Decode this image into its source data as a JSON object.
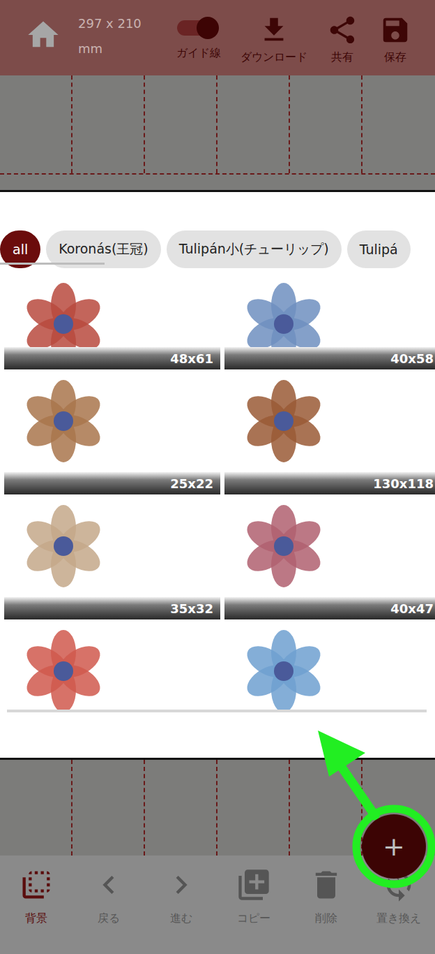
{
  "topbar": {
    "size": "297 x 210",
    "unit": "mm",
    "guide": {
      "label": "ガイド線",
      "on": true
    },
    "actions": [
      {
        "label": "ダウンロード"
      },
      {
        "label": "共有"
      },
      {
        "label": "保存"
      }
    ]
  },
  "categories": [
    {
      "label": "all",
      "selected": true
    },
    {
      "label": "Koronás(王冠)",
      "selected": false
    },
    {
      "label": "Tulipán小(チューリップ)",
      "selected": false
    },
    {
      "label": "Tulipá",
      "selected": false
    }
  ],
  "motifs": [
    {
      "size": "48x61",
      "color": "#b84a3e"
    },
    {
      "size": "40x58",
      "color": "#6f8fc0"
    },
    {
      "size": "25x22",
      "color": "#a9764c"
    },
    {
      "size": "130x118",
      "color": "#9a5a36"
    },
    {
      "size": "35x32",
      "color": "#c4a88a"
    },
    {
      "size": "40x47",
      "color": "#b06070"
    },
    {
      "color": "#d0594e"
    },
    {
      "color": "#6fa0d0"
    }
  ],
  "toolbar": [
    {
      "label": "背景",
      "selected": true,
      "disabled": false
    },
    {
      "label": "戻る",
      "selected": false,
      "disabled": true
    },
    {
      "label": "進む",
      "selected": false,
      "disabled": true
    },
    {
      "label": "コピー",
      "selected": false,
      "disabled": true
    },
    {
      "label": "削除",
      "selected": false,
      "disabled": true
    },
    {
      "label": "置き換え",
      "selected": false,
      "disabled": true
    }
  ],
  "fab": {
    "label": "+"
  }
}
